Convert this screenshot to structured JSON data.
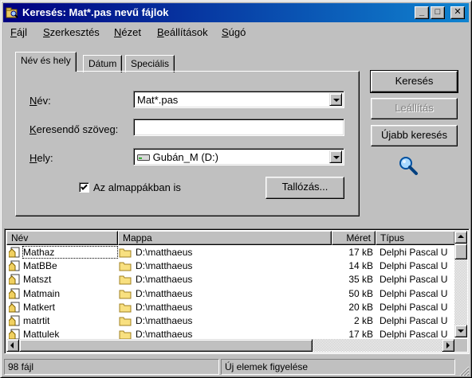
{
  "window": {
    "title": "Keresés: Mat*.pas nevű fájlok"
  },
  "titlebar_buttons": {
    "minimize": "_",
    "maximize": "□",
    "close": "✕"
  },
  "menu": [
    {
      "pre": "",
      "key": "F",
      "post": "ájl"
    },
    {
      "pre": "",
      "key": "S",
      "post": "zerkesztés"
    },
    {
      "pre": "",
      "key": "N",
      "post": "ézet"
    },
    {
      "pre": "",
      "key": "B",
      "post": "eállítások"
    },
    {
      "pre": "",
      "key": "S",
      "post": "úgó"
    }
  ],
  "tabs": [
    "Név és hely",
    "Dátum",
    "Speciális"
  ],
  "form": {
    "name_label": {
      "key": "N",
      "post": "év:"
    },
    "name_value": "Mat*.pas",
    "search_text_label": {
      "key": "K",
      "post": "eresendő szöveg:"
    },
    "search_text_value": "",
    "location_label": {
      "key": "H",
      "post": "ely:"
    },
    "location_value": "Gubán_M (D:)",
    "subfolders_label": "Az almappákban is",
    "subfolders_checked": true,
    "browse_button": "Tallózás..."
  },
  "buttons": {
    "search": "Keresés",
    "stop": "Leállítás",
    "new_search": "Újabb keresés"
  },
  "list": {
    "columns": [
      "Név",
      "Mappa",
      "Méret",
      "Típus"
    ],
    "rows": [
      {
        "name": "Mathaz",
        "folder": "D:\\matthaeus",
        "size": "17 kB",
        "type": "Delphi Pascal U"
      },
      {
        "name": "MatBBe",
        "folder": "D:\\matthaeus",
        "size": "14 kB",
        "type": "Delphi Pascal U"
      },
      {
        "name": "Matszt",
        "folder": "D:\\matthaeus",
        "size": "35 kB",
        "type": "Delphi Pascal U"
      },
      {
        "name": "Matmain",
        "folder": "D:\\matthaeus",
        "size": "50 kB",
        "type": "Delphi Pascal U"
      },
      {
        "name": "Matkert",
        "folder": "D:\\matthaeus",
        "size": "20 kB",
        "type": "Delphi Pascal U"
      },
      {
        "name": "matrtit",
        "folder": "D:\\matthaeus",
        "size": "2 kB",
        "type": "Delphi Pascal U"
      },
      {
        "name": "Mattulek",
        "folder": "D:\\matthaeus",
        "size": "17 kB",
        "type": "Delphi Pascal U"
      }
    ]
  },
  "status": {
    "count": "98 fájl",
    "monitor": "Új elemek figyelése"
  },
  "colors": {
    "title_start": "#000080",
    "title_end": "#1084d0",
    "face": "#c0c0c0"
  }
}
